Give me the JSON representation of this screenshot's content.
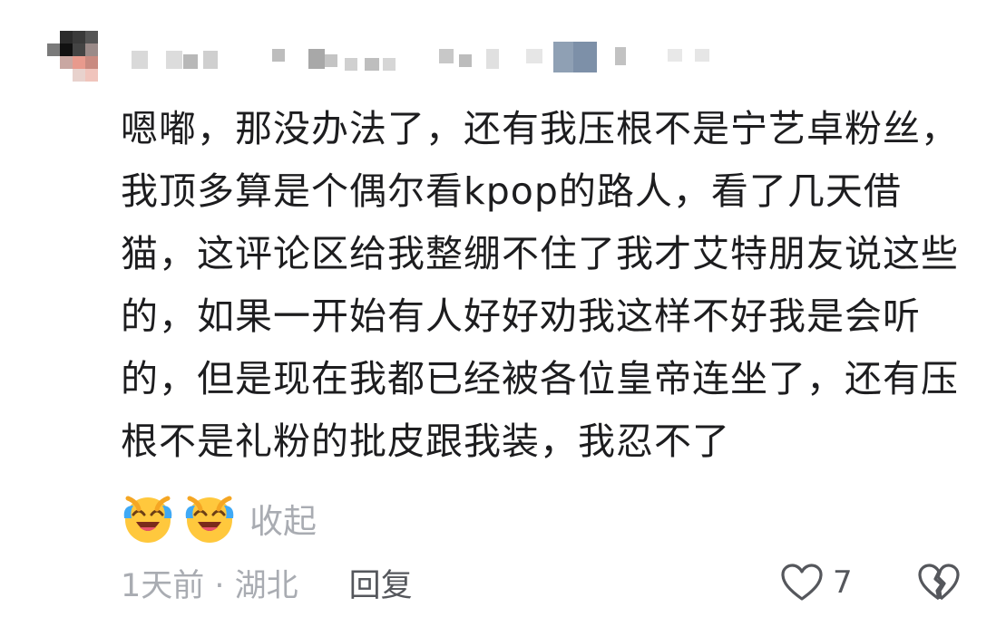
{
  "comment": {
    "text": "嗯嘟，那没办法了，还有我压根不是宁艺卓粉丝，我顶多算是个偶尔看kpop的路人，看了几天借猫，这评论区给我整绷不住了我才艾特朋友说这些的，如果一开始有人好好劝我这样不好我是会听的，但是现在我都已经被各位皇帝连坐了，还有压根不是礼粉的批皮跟我装，我忍不了",
    "emojis": [
      "laughing-crying-emoji",
      "laughing-crying-emoji"
    ],
    "collapse_label": "收起"
  },
  "meta": {
    "time_location": "1天前 · 湖北",
    "reply_label": "回复",
    "like_count": "7"
  },
  "colors": {
    "text": "#1d1d1f",
    "muted": "#a9acb2",
    "action": "#55575c",
    "emoji_face": "#ffc83d",
    "emoji_tears": "#3fa9f5"
  }
}
